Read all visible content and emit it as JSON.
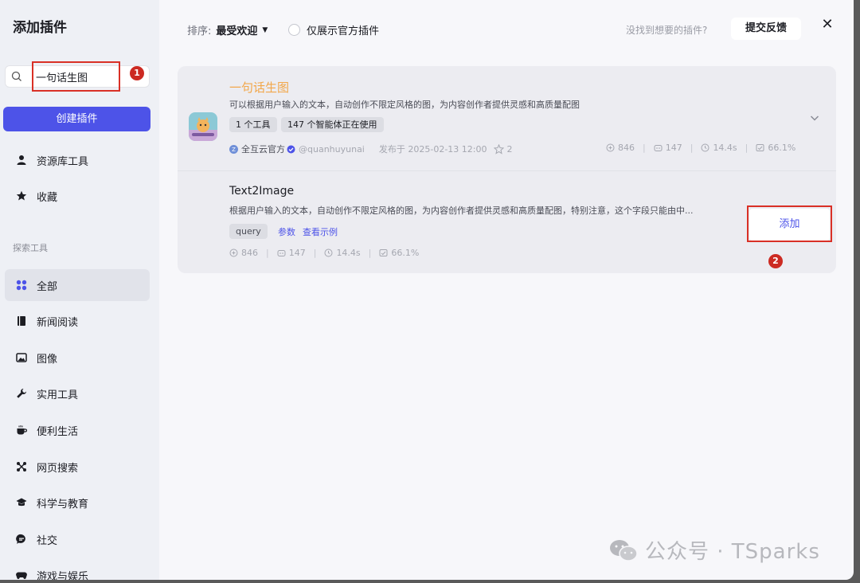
{
  "sidebar": {
    "title": "添加插件",
    "search": {
      "value": "一句话生图",
      "placeholder": ""
    },
    "create_button": "创建插件",
    "top_items": [
      {
        "label": "资源库工具",
        "icon": "person-icon"
      },
      {
        "label": "收藏",
        "icon": "star-icon"
      }
    ],
    "section_label": "探索工具",
    "categories": [
      {
        "label": "全部",
        "icon": "grid-icon",
        "active": true
      },
      {
        "label": "新闻阅读",
        "icon": "book-icon"
      },
      {
        "label": "图像",
        "icon": "image-icon"
      },
      {
        "label": "实用工具",
        "icon": "wrench-icon"
      },
      {
        "label": "便利生活",
        "icon": "cup-icon"
      },
      {
        "label": "网页搜索",
        "icon": "network-icon"
      },
      {
        "label": "科学与教育",
        "icon": "graduation-cap-icon"
      },
      {
        "label": "社交",
        "icon": "chat-icon"
      },
      {
        "label": "游戏与娱乐",
        "icon": "gamepad-icon"
      }
    ]
  },
  "topbar": {
    "sort_label": "排序:",
    "sort_value": "最受欢迎",
    "official_only": "仅展示官方插件",
    "not_found": "没找到想要的插件?",
    "feedback": "提交反馈"
  },
  "plugin": {
    "title": "一句话生图",
    "description": "可以根据用户输入的文本，自动创作不限定风格的图，为内容创作者提供灵感和高质量配图",
    "tags": [
      "1 个工具",
      "147 个智能体正在使用"
    ],
    "publisher": "全互云官方",
    "handle": "@quanhuyunai",
    "published": "发布于 2025-02-13 12:00",
    "stars": "2",
    "stats": {
      "calls": "846",
      "bots": "147",
      "latency": "14.4s",
      "success": "66.1%"
    }
  },
  "tool": {
    "title": "Text2Image",
    "description": "根据用户输入的文本，自动创作不限定风格的图，为内容创作者提供灵感和高质量配图，特别注意，这个字段只能由中...",
    "param_tag": "query",
    "params_link": "参数",
    "example_link": "查看示例",
    "add_button": "添加",
    "stats": {
      "calls": "846",
      "bots": "147",
      "latency": "14.4s",
      "success": "66.1%"
    }
  },
  "annotations": {
    "step1": "1",
    "step2": "2"
  },
  "watermark": "公众号 · TSparks",
  "colors": {
    "accent": "#4d53e8",
    "title_orange": "#f2a74a",
    "annotation_red": "#d93026"
  }
}
